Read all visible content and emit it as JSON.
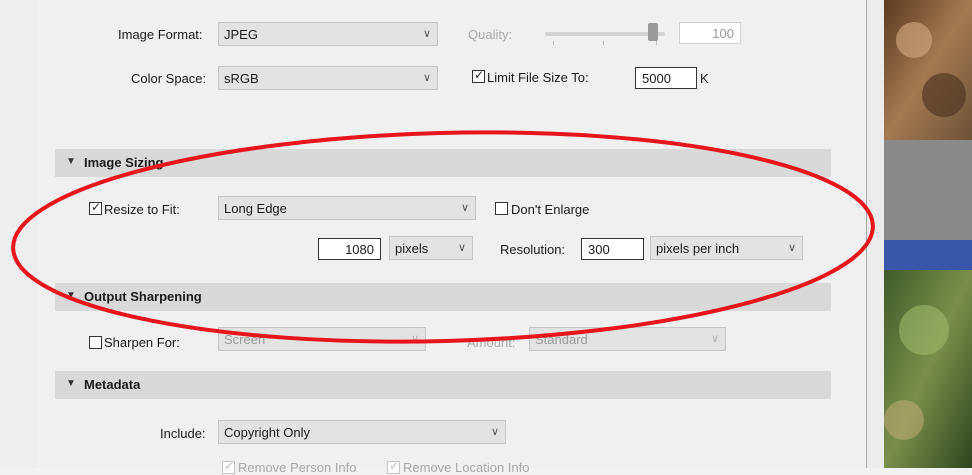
{
  "file_settings": {
    "image_format_label": "Image Format:",
    "image_format_value": "JPEG",
    "quality_label": "Quality:",
    "quality_value": "100",
    "quality_level_fraction": 0.9,
    "color_space_label": "Color Space:",
    "color_space_value": "sRGB",
    "limit_file_size_label": "Limit File Size To:",
    "limit_file_size_checked": true,
    "limit_file_size_value": "5000",
    "limit_file_size_unit": "K"
  },
  "image_sizing": {
    "header": "Image Sizing",
    "resize_label": "Resize to Fit:",
    "resize_checked": true,
    "resize_mode": "Long Edge",
    "dont_enlarge_label": "Don't Enlarge",
    "dont_enlarge_checked": false,
    "dimension_value": "1080",
    "dimension_unit": "pixels",
    "resolution_label": "Resolution:",
    "resolution_value": "300",
    "resolution_unit": "pixels per inch"
  },
  "output_sharpening": {
    "header": "Output Sharpening",
    "sharpen_label": "Sharpen For:",
    "sharpen_checked": false,
    "sharpen_for_value": "Screen",
    "amount_label": "Amount:",
    "amount_value": "Standard"
  },
  "metadata": {
    "header": "Metadata",
    "include_label": "Include:",
    "include_value": "Copyright Only",
    "remove_person_label": "Remove Person Info",
    "remove_location_label": "Remove Location Info"
  },
  "colors": {
    "annotation_red": "#e8141c",
    "header_bg": "#d9d9d9",
    "panel_bg": "#f0f0f0"
  }
}
